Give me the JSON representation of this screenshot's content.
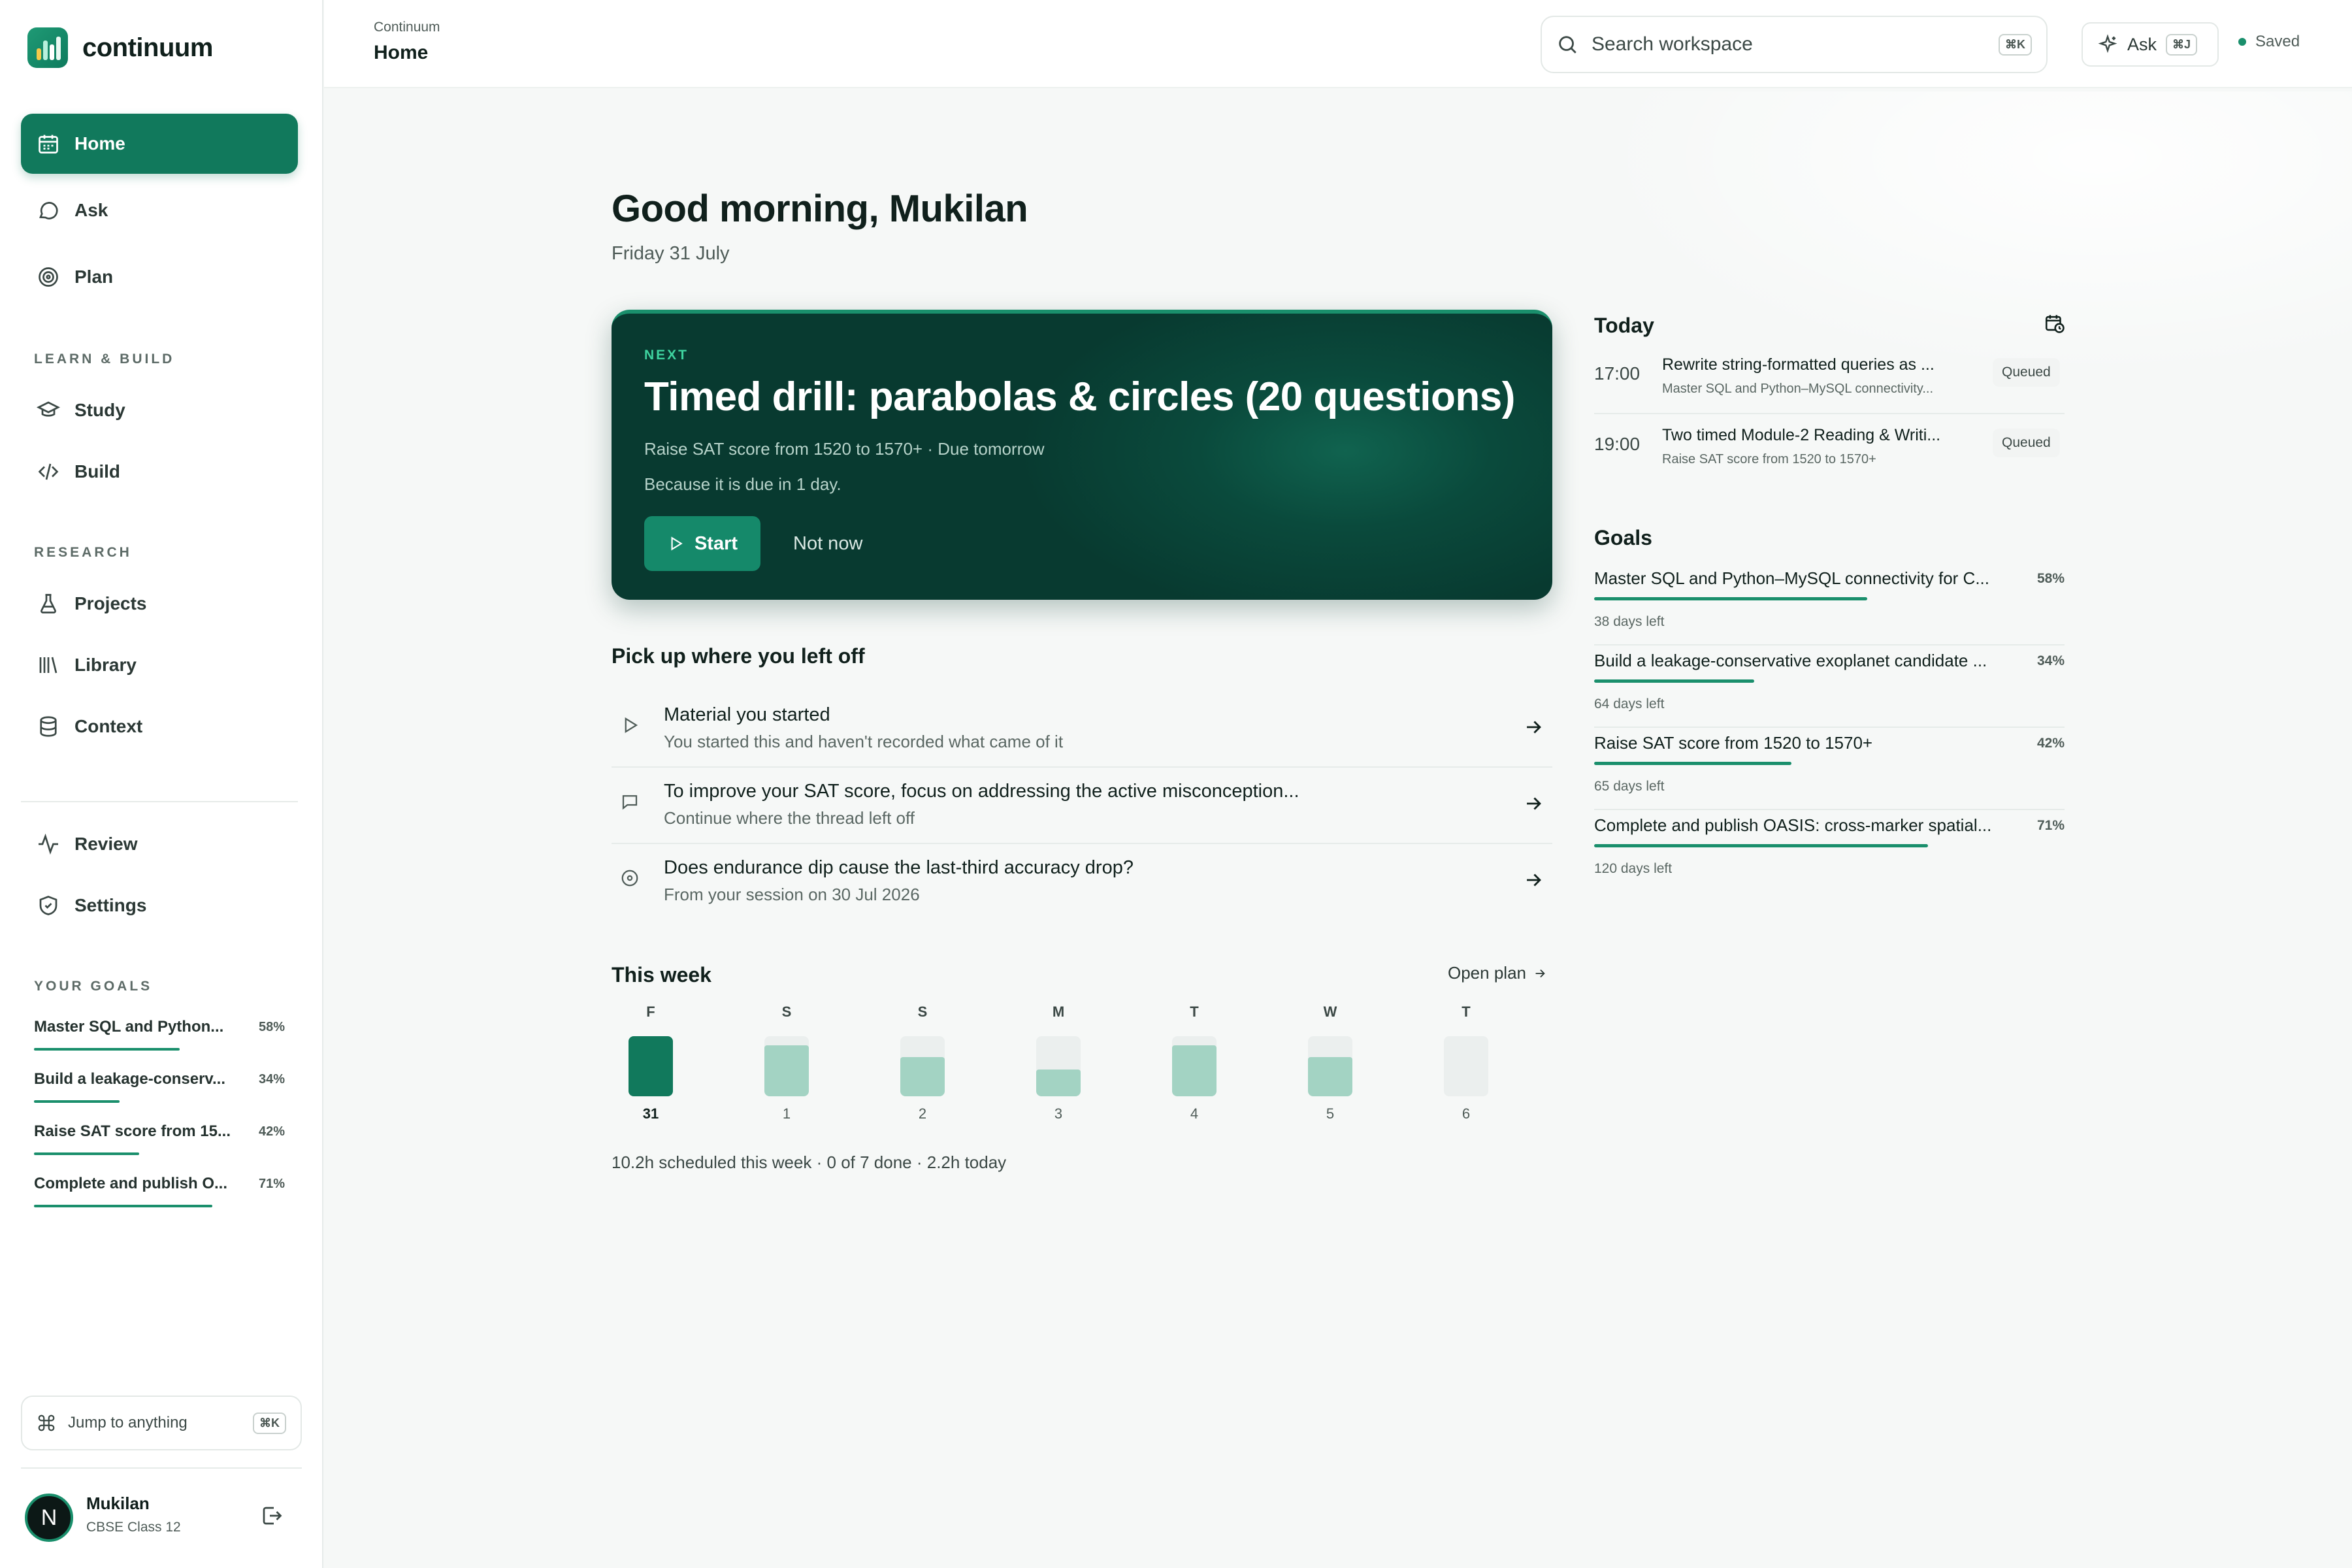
{
  "app": {
    "name": "continuum"
  },
  "sidebar": {
    "nav_top": [
      {
        "label": "Home",
        "icon": "calendar-icon",
        "active": true
      },
      {
        "label": "Ask",
        "icon": "chat-bubble-icon"
      },
      {
        "label": "Plan",
        "icon": "target-icon"
      }
    ],
    "section_learn": "LEARN & BUILD",
    "nav_learn": [
      {
        "label": "Study",
        "icon": "graduation-cap-icon"
      },
      {
        "label": "Build",
        "icon": "code-icon"
      }
    ],
    "section_research": "RESEARCH",
    "nav_research": [
      {
        "label": "Projects",
        "icon": "flask-icon"
      },
      {
        "label": "Library",
        "icon": "books-icon"
      },
      {
        "label": "Context",
        "icon": "database-icon"
      }
    ],
    "nav_bottom": [
      {
        "label": "Review",
        "icon": "activity-icon"
      },
      {
        "label": "Settings",
        "icon": "shield-icon"
      }
    ],
    "section_goals": "YOUR GOALS",
    "goals": [
      {
        "title": "Master SQL and Python...",
        "percent": "58%",
        "progress": 0.58
      },
      {
        "title": "Build a leakage-conserv...",
        "percent": "34%",
        "progress": 0.34
      },
      {
        "title": "Raise SAT score from 15...",
        "percent": "42%",
        "progress": 0.42
      },
      {
        "title": "Complete and publish O...",
        "percent": "71%",
        "progress": 0.71
      }
    ],
    "jump": {
      "label": "Jump to anything",
      "shortcut": "⌘K"
    },
    "user": {
      "initial": "N",
      "name": "Mukilan",
      "subtitle": "CBSE Class 12"
    }
  },
  "topbar": {
    "breadcrumb": "Continuum",
    "title": "Home",
    "search_placeholder": "Search workspace",
    "search_shortcut": "⌘K",
    "ask_label": "Ask",
    "ask_shortcut": "⌘J",
    "status": "Saved"
  },
  "main": {
    "greeting": "Good morning, Mukilan",
    "date": "Friday 31 July",
    "next": {
      "eyebrow": "NEXT",
      "title": "Timed drill: parabolas & circles (20 questions)",
      "meta": "Raise SAT score from 1520 to 1570+ · Due tomorrow",
      "reason": "Because it is due in 1 day.",
      "start_label": "Start",
      "dismiss_label": "Not now"
    },
    "pickup_title": "Pick up where you left off",
    "pickup": [
      {
        "title": "Material you started",
        "subtitle": "You started this and haven't recorded what came of it",
        "icon": "play-icon"
      },
      {
        "title": "To improve your SAT score, focus on addressing the active misconception...",
        "subtitle": "Continue where the thread left off",
        "icon": "chat-bubble-icon"
      },
      {
        "title": "Does endurance dip cause the last-third accuracy drop?",
        "subtitle": "From your session on 30 Jul 2026",
        "icon": "target-icon"
      }
    ],
    "week_title": "This week",
    "open_plan": "Open plan",
    "week": [
      {
        "letter": "F",
        "date": "31",
        "load": 1.0,
        "today": true
      },
      {
        "letter": "S",
        "date": "1",
        "load": 0.85
      },
      {
        "letter": "S",
        "date": "2",
        "load": 0.65
      },
      {
        "letter": "M",
        "date": "3",
        "load": 0.45
      },
      {
        "letter": "T",
        "date": "4",
        "load": 0.85
      },
      {
        "letter": "W",
        "date": "5",
        "load": 0.65
      },
      {
        "letter": "T",
        "date": "6",
        "load": 0.0
      }
    ],
    "week_summary": "10.2h scheduled this week · 0 of 7 done · 2.2h today"
  },
  "today": {
    "title": "Today",
    "items": [
      {
        "time": "17:00",
        "title": "Rewrite string-formatted queries as ...",
        "subtitle": "Master SQL and Python–MySQL connectivity...",
        "status": "Queued"
      },
      {
        "time": "19:00",
        "title": "Two timed Module-2 Reading & Writi...",
        "subtitle": "Raise SAT score from 1520 to 1570+",
        "status": "Queued"
      }
    ]
  },
  "goals": {
    "title": "Goals",
    "items": [
      {
        "title": "Master SQL and Python–MySQL connectivity for C...",
        "percent": "58%",
        "progress": 0.58,
        "days": "38 days left"
      },
      {
        "title": "Build a leakage-conservative exoplanet candidate ...",
        "percent": "34%",
        "progress": 0.34,
        "days": "64 days left"
      },
      {
        "title": "Raise SAT score from 1520 to 1570+",
        "percent": "42%",
        "progress": 0.42,
        "days": "65 days left"
      },
      {
        "title": "Complete and publish OASIS: cross-marker spatial...",
        "percent": "71%",
        "progress": 0.71,
        "days": "120 days left"
      }
    ]
  },
  "colors": {
    "accent": "#11795c",
    "hero_bg": "#083a30",
    "bar_today": "#11795c",
    "bar_planned": "#a3d3c3"
  }
}
